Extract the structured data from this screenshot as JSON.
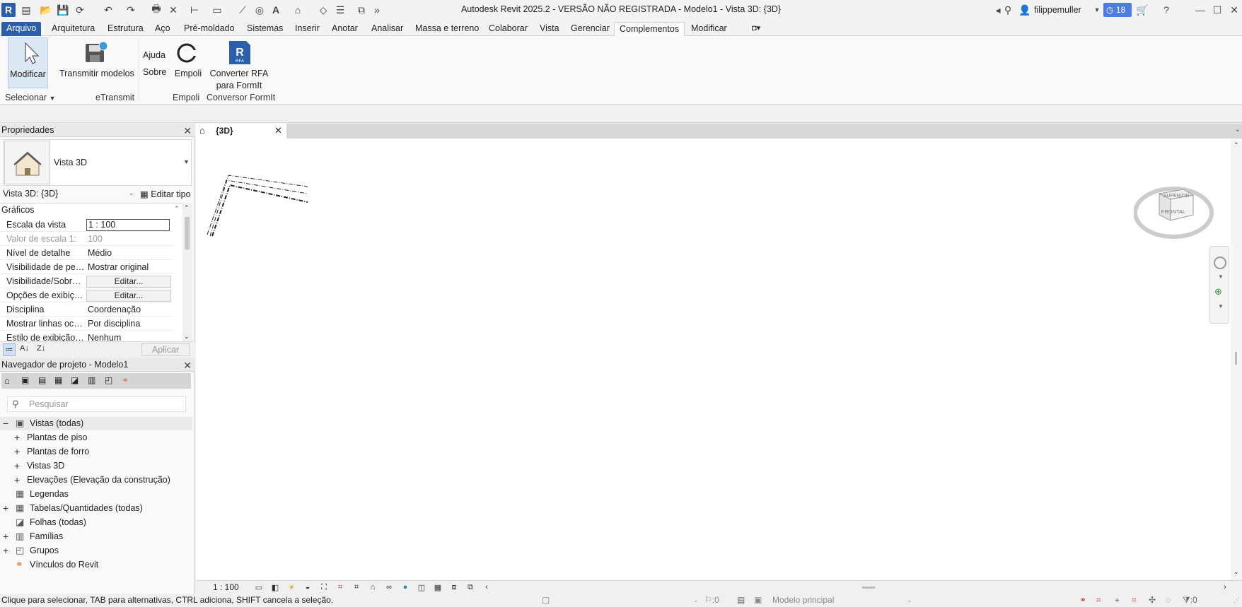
{
  "app_title": "Autodesk Revit 2025.2 - VERSÃO NÃO REGISTRADA - Modelo1 - Vista 3D: {3D}",
  "user": {
    "name": "filippemuller",
    "notifications": "18"
  },
  "tabs": [
    "Arquivo",
    "Arquitetura",
    "Estrutura",
    "Aço",
    "Pré-moldado",
    "Sistemas",
    "Inserir",
    "Anotar",
    "Analisar",
    "Massa e terreno",
    "Colaborar",
    "Vista",
    "Gerenciar",
    "Complementos",
    "Modificar"
  ],
  "active_tab": "Complementos",
  "ribbon": {
    "modify_label": "Modificar",
    "transmit_label": "Transmitir modelos",
    "help_label": "Ajuda",
    "about_label": "Sobre",
    "empoli_label": "Empoli",
    "convert_label_1": "Converter RFA",
    "convert_label_2": "para FormIt",
    "rfa_badge": "RFA",
    "panels": {
      "select": "Selecionar",
      "etransmit": "eTransmit",
      "empoli": "Empoli",
      "formit": "Conversor FormIt"
    }
  },
  "properties": {
    "title": "Propriedades",
    "type_name": "Vista 3D",
    "instance_selector": "Vista 3D: {3D}",
    "edit_type": "Editar tipo",
    "section": "Gráficos",
    "rows": [
      {
        "name": "Escala da vista",
        "value": "1 : 100"
      },
      {
        "name": "Valor de escala    1:",
        "value": "100"
      },
      {
        "name": "Nível de detalhe",
        "value": "Médio"
      },
      {
        "name": "Visibilidade de peças",
        "value": "Mostrar original"
      },
      {
        "name": "Visibilidade/Sobrep...",
        "value": "Editar..."
      },
      {
        "name": "Opções de exibiçõo...",
        "value": "Editar..."
      },
      {
        "name": "Disciplina",
        "value": "Coordenação"
      },
      {
        "name": "Mostrar linhas ocult...",
        "value": "Por disciplina"
      },
      {
        "name": "Estilo de exibição d...",
        "value": "Nenhum"
      }
    ],
    "apply": "Aplicar"
  },
  "browser": {
    "title": "Navegador de projeto - Modelo1",
    "search_placeholder": "Pesquisar",
    "items": [
      {
        "label": "Vistas (todas)",
        "indent": 0,
        "expander": "−",
        "icon": "views"
      },
      {
        "label": "Plantas de piso",
        "indent": 1,
        "expander": "+",
        "icon": ""
      },
      {
        "label": "Plantas de forro",
        "indent": 1,
        "expander": "+",
        "icon": ""
      },
      {
        "label": "Vistas 3D",
        "indent": 1,
        "expander": "+",
        "icon": ""
      },
      {
        "label": "Elevações (Elevação da construção)",
        "indent": 1,
        "expander": "+",
        "icon": ""
      },
      {
        "label": "Legendas",
        "indent": 0,
        "expander": "",
        "icon": "legend"
      },
      {
        "label": "Tabelas/Quantidades (todas)",
        "indent": 0,
        "expander": "+",
        "icon": "table"
      },
      {
        "label": "Folhas (todas)",
        "indent": 0,
        "expander": "",
        "icon": "sheet"
      },
      {
        "label": "Famílias",
        "indent": 0,
        "expander": "+",
        "icon": "family"
      },
      {
        "label": "Grupos",
        "indent": 0,
        "expander": "+",
        "icon": "group"
      },
      {
        "label": "Vínculos do Revit",
        "indent": 0,
        "expander": "",
        "icon": "link"
      }
    ]
  },
  "view": {
    "tab_label": "{3D}",
    "scale": "1 : 100",
    "viewcube_top": "SUPERIOR",
    "viewcube_front": "FRONTAL"
  },
  "status": {
    "hint": "Clique para selecionar, TAB para alternativas, CTRL adiciona, SHIFT cancela a seleção.",
    "workset_count": ":0",
    "model": "Modelo principal",
    "filter_count": ":0"
  },
  "colors": {
    "file_tab": "#2c5fa8",
    "accent": "#2c5fa8",
    "badge": "#4d7de0"
  }
}
